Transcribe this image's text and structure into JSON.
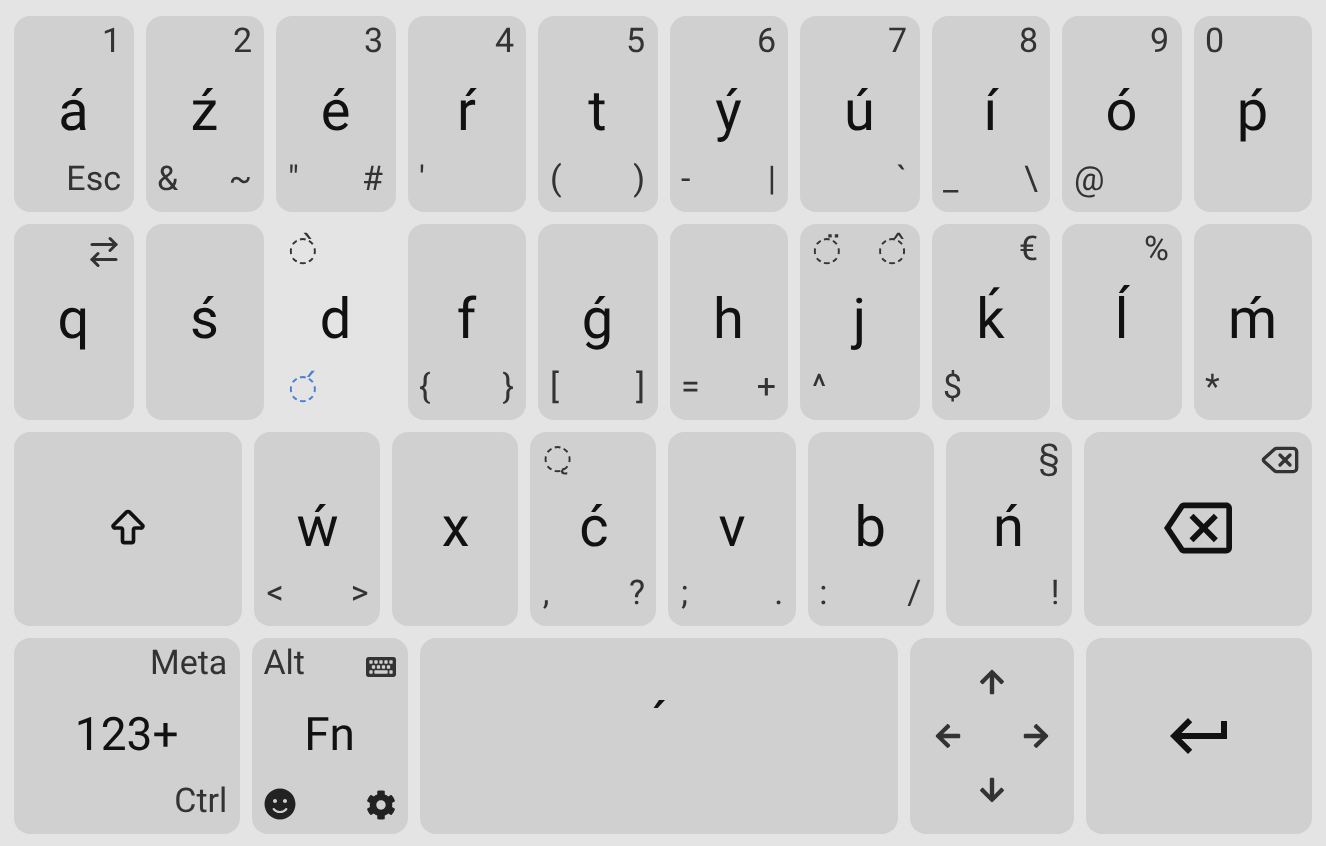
{
  "rows": [
    {
      "keys": [
        {
          "kind": "letter",
          "main": "á",
          "tr": "1",
          "br": "Esc",
          "pressed": false
        },
        {
          "kind": "letter",
          "main": "ź",
          "tr": "2",
          "bl": "&",
          "br": "~",
          "pressed": false
        },
        {
          "kind": "letter",
          "main": "é",
          "tr": "3",
          "bl": "\"",
          "br": "#",
          "pressed": false
        },
        {
          "kind": "letter",
          "main": "ŕ",
          "tr": "4",
          "bl": "'",
          "pressed": false
        },
        {
          "kind": "letter",
          "main": "t",
          "tr": "5",
          "bl": "(",
          "br": ")",
          "pressed": false
        },
        {
          "kind": "letter",
          "main": "ý",
          "tr": "6",
          "bl": "-",
          "br": "|",
          "pressed": false
        },
        {
          "kind": "letter",
          "main": "ú",
          "tr": "7",
          "br": "`",
          "pressed": false
        },
        {
          "kind": "letter",
          "main": "í",
          "tr": "8",
          "bl": "_",
          "br": "\\",
          "pressed": false
        },
        {
          "kind": "letter",
          "main": "ó",
          "tr": "9",
          "bl": "@",
          "pressed": false
        },
        {
          "kind": "letter",
          "main": "ṕ",
          "tl": "0",
          "pressed": false
        }
      ]
    },
    {
      "keys": [
        {
          "kind": "letter_tab",
          "main": "q",
          "pressed": false
        },
        {
          "kind": "letter",
          "main": "ś",
          "pressed": false
        },
        {
          "kind": "letter",
          "main": "d",
          "tl": "◌̀",
          "bl": "◌́",
          "bl_active": true,
          "pressed": true
        },
        {
          "kind": "letter",
          "main": "f",
          "bl": "{",
          "br": "}",
          "pressed": false
        },
        {
          "kind": "letter",
          "main": "ǵ",
          "bl": "[",
          "br": "]",
          "pressed": false
        },
        {
          "kind": "letter",
          "main": "h",
          "bl": "=",
          "br": "+",
          "pressed": false
        },
        {
          "kind": "letter",
          "main": "j",
          "tl": "◌̈",
          "tr": "◌̂",
          "bl": "^",
          "pressed": false
        },
        {
          "kind": "letter",
          "main": "ḱ",
          "tr": "€",
          "bl": "$",
          "pressed": false
        },
        {
          "kind": "letter",
          "main": "ĺ",
          "tr": "%",
          "pressed": false
        },
        {
          "kind": "letter",
          "main": "ḿ",
          "bl": "*",
          "pressed": false
        }
      ]
    },
    {
      "keys": [
        {
          "kind": "shift",
          "pressed": false
        },
        {
          "kind": "letter",
          "main": "ẃ",
          "bl": "<",
          "br": ">",
          "pressed": false
        },
        {
          "kind": "letter",
          "main": "x",
          "pressed": false
        },
        {
          "kind": "letter",
          "main": "ć",
          "tl": "◌̨",
          "bl": ",",
          "br": "?",
          "pressed": false
        },
        {
          "kind": "letter",
          "main": "v",
          "bl": ";",
          "br": ".",
          "pressed": false
        },
        {
          "kind": "letter",
          "main": "b",
          "bl": ":",
          "br": "/",
          "pressed": false
        },
        {
          "kind": "letter",
          "main": "ń",
          "tr": "§",
          "br": "!",
          "pressed": false
        },
        {
          "kind": "backspace",
          "pressed": false
        }
      ]
    },
    {
      "keys": [
        {
          "kind": "numbers",
          "main": "123+",
          "tr": "Meta",
          "br": "Ctrl",
          "pressed": false
        },
        {
          "kind": "fn",
          "main": "Fn",
          "tl": "Alt",
          "pressed": false
        },
        {
          "kind": "space",
          "main": "´",
          "pressed": false
        },
        {
          "kind": "arrows"
        },
        {
          "kind": "enter",
          "pressed": false
        }
      ]
    }
  ]
}
